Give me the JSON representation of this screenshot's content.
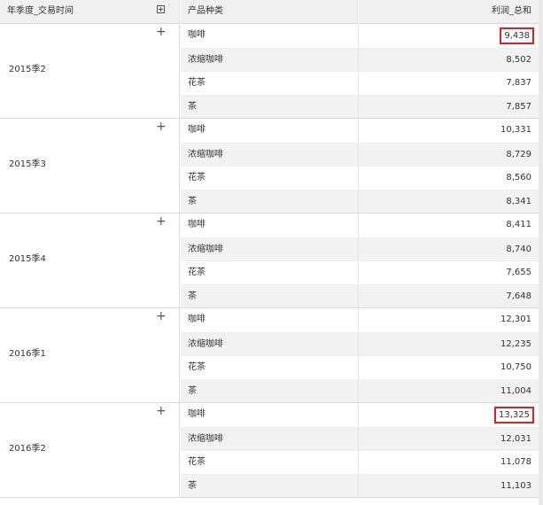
{
  "header": {
    "quarter_col": "年季度_交易时间",
    "product_col": "产品种类",
    "value_col": "利润_总和",
    "expand_icon": "plus-square-icon"
  },
  "groups": [
    {
      "quarter": "2015季2",
      "rows": [
        {
          "product": "咖啡",
          "value": "9,438",
          "highlighted": true
        },
        {
          "product": "浓缩咖啡",
          "value": "8,502"
        },
        {
          "product": "花茶",
          "value": "7,837"
        },
        {
          "product": "茶",
          "value": "7,857"
        }
      ]
    },
    {
      "quarter": "2015季3",
      "rows": [
        {
          "product": "咖啡",
          "value": "10,331"
        },
        {
          "product": "浓缩咖啡",
          "value": "8,729"
        },
        {
          "product": "花茶",
          "value": "8,560"
        },
        {
          "product": "茶",
          "value": "8,341"
        }
      ]
    },
    {
      "quarter": "2015季4",
      "rows": [
        {
          "product": "咖啡",
          "value": "8,411"
        },
        {
          "product": "浓缩咖啡",
          "value": "8,740"
        },
        {
          "product": "花茶",
          "value": "7,655"
        },
        {
          "product": "茶",
          "value": "7,648"
        }
      ]
    },
    {
      "quarter": "2016季1",
      "rows": [
        {
          "product": "咖啡",
          "value": "12,301"
        },
        {
          "product": "浓缩咖啡",
          "value": "12,235"
        },
        {
          "product": "花茶",
          "value": "10,750"
        },
        {
          "product": "茶",
          "value": "11,004"
        }
      ]
    },
    {
      "quarter": "2016季2",
      "rows": [
        {
          "product": "咖啡",
          "value": "13,325",
          "highlighted": true
        },
        {
          "product": "浓缩咖啡",
          "value": "12,031"
        },
        {
          "product": "花茶",
          "value": "11,078"
        },
        {
          "product": "茶",
          "value": "11,103"
        }
      ]
    }
  ],
  "icons": {
    "expand_row": "plus-icon",
    "expand_row_glyph": "+"
  },
  "colors": {
    "highlight_border": "#e02020",
    "header_bg": "#f0f0f0",
    "alt_row_bg": "#f2f2f2"
  }
}
